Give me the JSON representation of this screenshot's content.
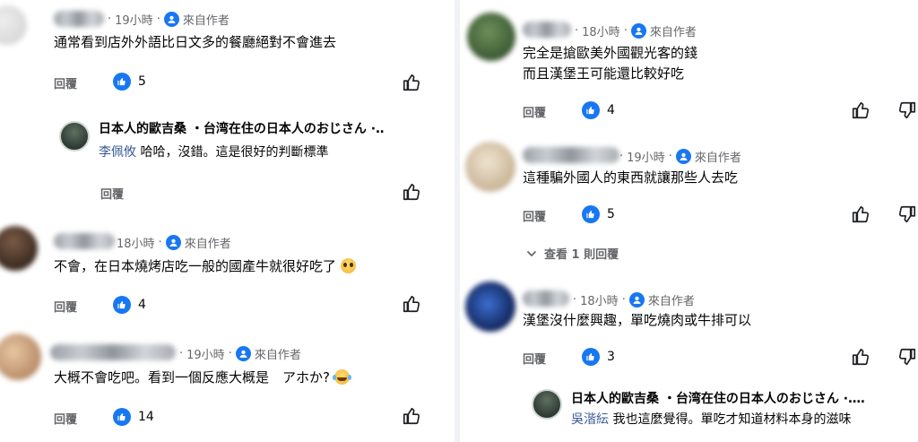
{
  "common": {
    "reply_label": "回覆",
    "author_label": "來自作者",
    "dot": "·"
  },
  "left": {
    "c1": {
      "time": "19小時",
      "text": "通常看到店外外語比日文多的餐廳絕對不會進去",
      "likes": "5"
    },
    "r1": {
      "author": "日本人的歐吉桑 ・台湾在住の日本人のおじさん ·‥",
      "mention": "李佩攸",
      "text": " 哈哈，沒錯。這是很好的判斷標準"
    },
    "c2": {
      "time": "18小時",
      "text": "不會，在日本燒烤店吃一般的國產牛就很好吃了",
      "likes": "4"
    },
    "c3": {
      "time": "19小時",
      "text": "大概不會吃吧。看到一個反應大概是　アホか?",
      "likes": "14"
    }
  },
  "right": {
    "c1": {
      "time": "18小時",
      "text_line1": "完全是搶歐美外國觀光客的錢",
      "text_line2": "而且漢堡王可能還比較好吃",
      "likes": "4"
    },
    "c2": {
      "time": "19小時",
      "text": "這種騙外國人的東西就讓那些人去吃",
      "likes": "5",
      "view_replies": "查看 1 則回覆"
    },
    "c3": {
      "time": "18小時",
      "text": "漢堡沒什麼興趣，單吃燒肉或牛排可以",
      "likes": "3"
    },
    "r1": {
      "author": "日本人的歐吉桑 ・台湾在住の日本人のおじさん ·‥‥",
      "mention": "吳湝紜",
      "text": " 我也這麼覺得。單吃才知道材料本身的滋味"
    }
  },
  "colors": {
    "accent": "#1877f2",
    "secondary_text": "#65676b",
    "mention": "#385898"
  }
}
